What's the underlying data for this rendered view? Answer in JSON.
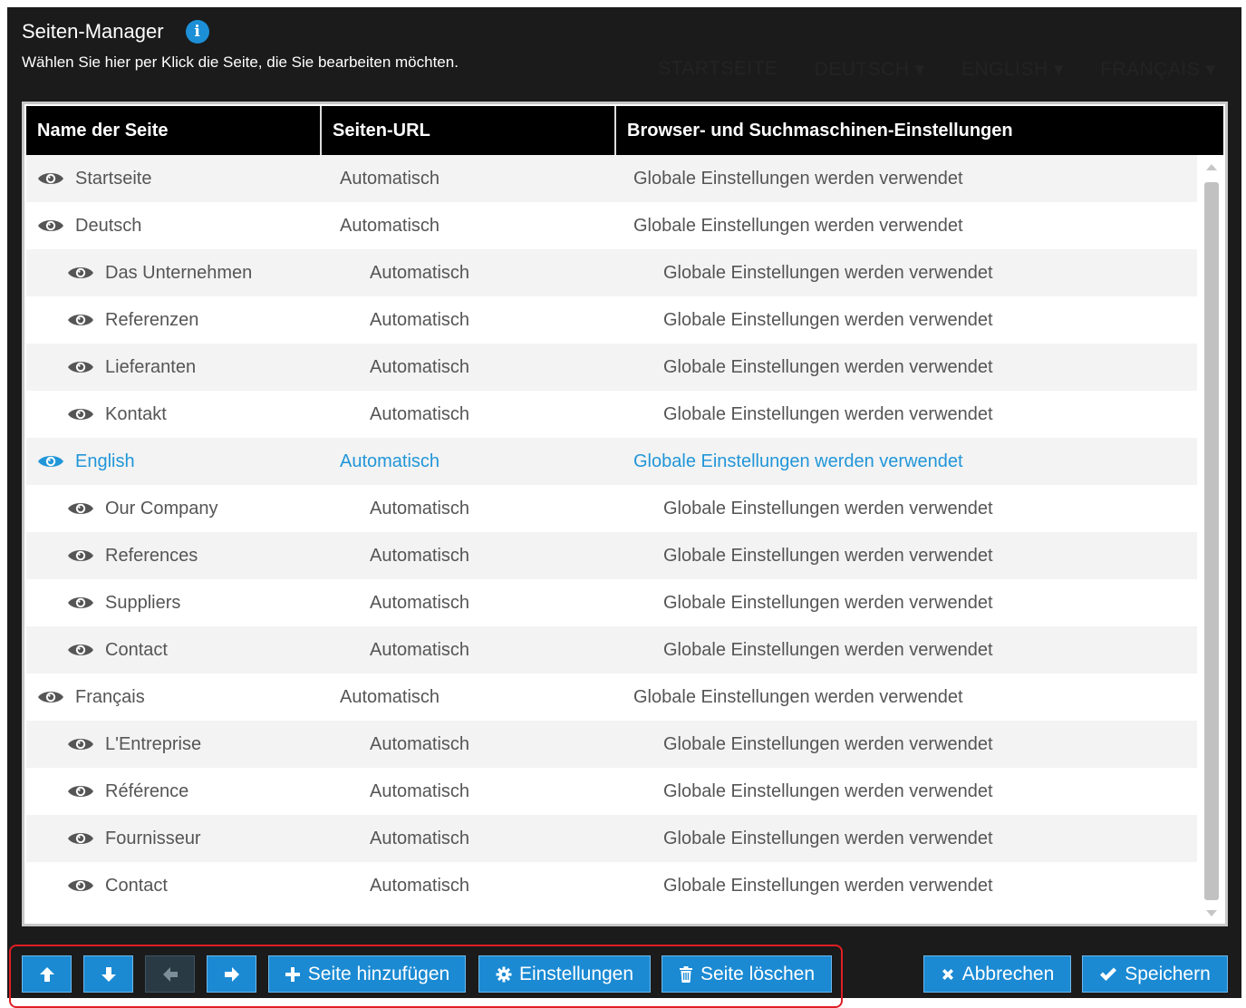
{
  "header": {
    "title": "Seiten-Manager",
    "info_icon": "info-circle-icon",
    "subtitle": "Wählen Sie hier per Klick die Seite, die Sie bearbeiten möchten."
  },
  "background_nav": [
    "STARTSEITE",
    "DEUTSCH ▾",
    "ENGLISH ▾",
    "FRANÇAIS ▾"
  ],
  "table": {
    "columns": [
      "Name der Seite",
      "Seiten-URL",
      "Browser- und Suchmaschinen-Einstellungen"
    ],
    "rows": [
      {
        "name": "Startseite",
        "url": "Automatisch",
        "settings": "Globale Einstellungen werden verwendet",
        "level": 0,
        "active": false
      },
      {
        "name": "Deutsch",
        "url": "Automatisch",
        "settings": "Globale Einstellungen werden verwendet",
        "level": 0,
        "active": false
      },
      {
        "name": "Das Unternehmen",
        "url": "Automatisch",
        "settings": "Globale Einstellungen werden verwendet",
        "level": 1,
        "active": false
      },
      {
        "name": "Referenzen",
        "url": "Automatisch",
        "settings": "Globale Einstellungen werden verwendet",
        "level": 1,
        "active": false
      },
      {
        "name": "Lieferanten",
        "url": "Automatisch",
        "settings": "Globale Einstellungen werden verwendet",
        "level": 1,
        "active": false
      },
      {
        "name": "Kontakt",
        "url": "Automatisch",
        "settings": "Globale Einstellungen werden verwendet",
        "level": 1,
        "active": false
      },
      {
        "name": "English",
        "url": "Automatisch",
        "settings": "Globale Einstellungen werden verwendet",
        "level": 0,
        "active": true
      },
      {
        "name": "Our Company",
        "url": "Automatisch",
        "settings": "Globale Einstellungen werden verwendet",
        "level": 1,
        "active": false
      },
      {
        "name": "References",
        "url": "Automatisch",
        "settings": "Globale Einstellungen werden verwendet",
        "level": 1,
        "active": false
      },
      {
        "name": "Suppliers",
        "url": "Automatisch",
        "settings": "Globale Einstellungen werden verwendet",
        "level": 1,
        "active": false
      },
      {
        "name": "Contact",
        "url": "Automatisch",
        "settings": "Globale Einstellungen werden verwendet",
        "level": 1,
        "active": false
      },
      {
        "name": "Français",
        "url": "Automatisch",
        "settings": "Globale Einstellungen werden verwendet",
        "level": 0,
        "active": false
      },
      {
        "name": "L'Entreprise",
        "url": "Automatisch",
        "settings": "Globale Einstellungen werden verwendet",
        "level": 1,
        "active": false
      },
      {
        "name": "Référence",
        "url": "Automatisch",
        "settings": "Globale Einstellungen werden verwendet",
        "level": 1,
        "active": false
      },
      {
        "name": "Fournisseur",
        "url": "Automatisch",
        "settings": "Globale Einstellungen werden verwendet",
        "level": 1,
        "active": false
      },
      {
        "name": "Contact",
        "url": "Automatisch",
        "settings": "Globale Einstellungen werden verwendet",
        "level": 1,
        "active": false
      }
    ]
  },
  "footer": {
    "move_up_icon": "arrow-up-icon",
    "move_down_icon": "arrow-down-icon",
    "move_left_icon": "arrow-left-icon",
    "move_right_icon": "arrow-right-icon",
    "add_page_label": "Seite hinzufügen",
    "settings_label": "Einstellungen",
    "delete_page_label": "Seite löschen",
    "cancel_label": "Abbrechen",
    "save_label": "Speichern"
  },
  "colors": {
    "accent": "#1b8ad3",
    "active_text": "#2196d8",
    "highlight_border": "#e01e24",
    "frame_bg": "#1b1b1b"
  }
}
